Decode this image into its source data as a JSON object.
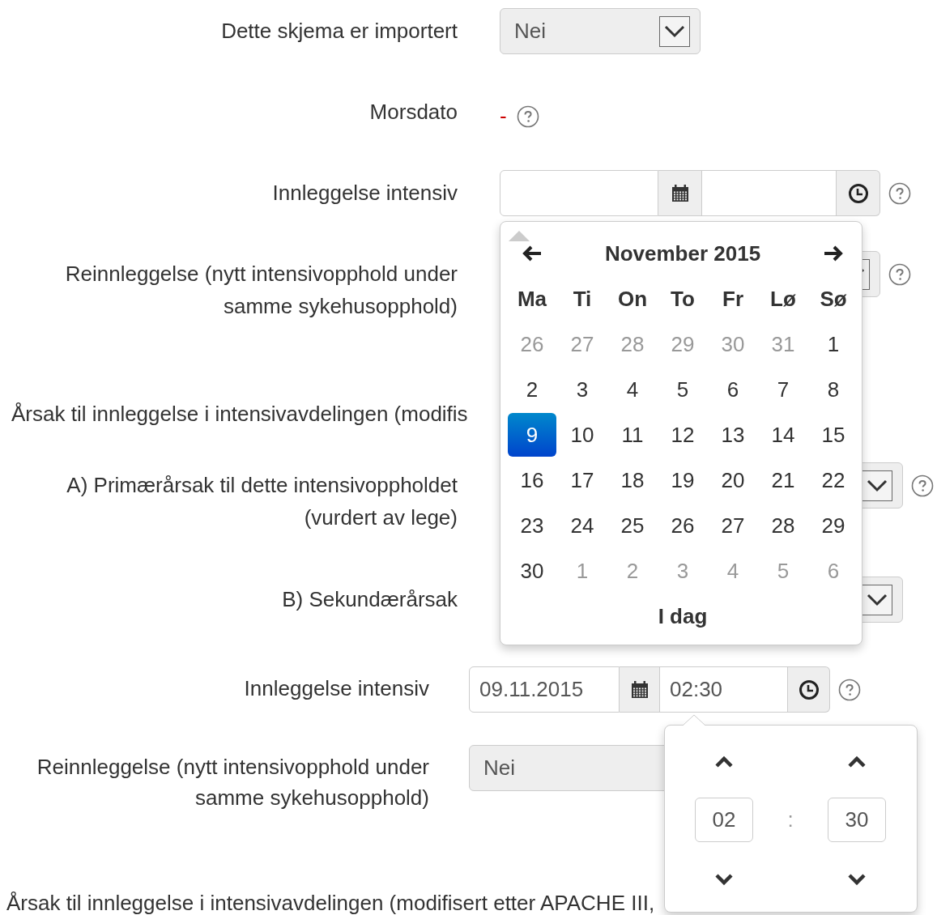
{
  "forms": [
    {
      "rows": [
        {
          "kind": "select",
          "label": "Dette skjema er importert",
          "value": "Nei",
          "help": false
        },
        {
          "kind": "static",
          "label": "Morsdato",
          "value": "-",
          "help": true
        },
        {
          "kind": "datetime",
          "label": "Innleggelse intensiv",
          "help": true
        },
        {
          "kind": "select",
          "label": "Reinnleggelse (nytt intensivopphold under samme sykehusopphold)",
          "help": true
        },
        {
          "kind": "heading",
          "label": "Årsak til innleggelse i intensivavdelingen (modifis"
        },
        {
          "kind": "select",
          "label": "A) Primærårsak til dette intensivoppholdet (vurdert av lege)",
          "help": true
        },
        {
          "kind": "select",
          "label": "B) Sekundærårsak",
          "help": false
        }
      ]
    },
    {
      "rows": [
        {
          "kind": "datetime",
          "label": "Innleggelse intensiv",
          "date": "09.11.2015",
          "time": "02:30",
          "help": true
        },
        {
          "kind": "select",
          "label": "Reinnleggelse (nytt intensivopphold under samme sykehusopphold)",
          "value": "Nei",
          "help": false
        },
        {
          "kind": "heading",
          "label": "Årsak til innleggelse i intensivavdelingen (modifisert etter APACHE III,"
        }
      ]
    }
  ],
  "calendar": {
    "title": "November 2015",
    "weekdays": [
      "Ma",
      "Ti",
      "On",
      "To",
      "Fr",
      "Lø",
      "Sø"
    ],
    "weeks": [
      [
        {
          "day": "26",
          "muted": true,
          "selected": false
        },
        {
          "day": "27",
          "muted": true,
          "selected": false
        },
        {
          "day": "28",
          "muted": true,
          "selected": false
        },
        {
          "day": "29",
          "muted": true,
          "selected": false
        },
        {
          "day": "30",
          "muted": true,
          "selected": false
        },
        {
          "day": "31",
          "muted": true,
          "selected": false
        },
        {
          "day": "1",
          "muted": false,
          "selected": false
        }
      ],
      [
        {
          "day": "2",
          "muted": false,
          "selected": false
        },
        {
          "day": "3",
          "muted": false,
          "selected": false
        },
        {
          "day": "4",
          "muted": false,
          "selected": false
        },
        {
          "day": "5",
          "muted": false,
          "selected": false
        },
        {
          "day": "6",
          "muted": false,
          "selected": false
        },
        {
          "day": "7",
          "muted": false,
          "selected": false
        },
        {
          "day": "8",
          "muted": false,
          "selected": false
        }
      ],
      [
        {
          "day": "9",
          "muted": false,
          "selected": true
        },
        {
          "day": "10",
          "muted": false,
          "selected": false
        },
        {
          "day": "11",
          "muted": false,
          "selected": false
        },
        {
          "day": "12",
          "muted": false,
          "selected": false
        },
        {
          "day": "13",
          "muted": false,
          "selected": false
        },
        {
          "day": "14",
          "muted": false,
          "selected": false
        },
        {
          "day": "15",
          "muted": false,
          "selected": false
        }
      ],
      [
        {
          "day": "16",
          "muted": false,
          "selected": false
        },
        {
          "day": "17",
          "muted": false,
          "selected": false
        },
        {
          "day": "18",
          "muted": false,
          "selected": false
        },
        {
          "day": "19",
          "muted": false,
          "selected": false
        },
        {
          "day": "20",
          "muted": false,
          "selected": false
        },
        {
          "day": "21",
          "muted": false,
          "selected": false
        },
        {
          "day": "22",
          "muted": false,
          "selected": false
        }
      ],
      [
        {
          "day": "23",
          "muted": false,
          "selected": false
        },
        {
          "day": "24",
          "muted": false,
          "selected": false
        },
        {
          "day": "25",
          "muted": false,
          "selected": false
        },
        {
          "day": "26",
          "muted": false,
          "selected": false
        },
        {
          "day": "27",
          "muted": false,
          "selected": false
        },
        {
          "day": "28",
          "muted": false,
          "selected": false
        },
        {
          "day": "29",
          "muted": false,
          "selected": false
        }
      ],
      [
        {
          "day": "30",
          "muted": false,
          "selected": false
        },
        {
          "day": "1",
          "muted": true,
          "selected": false
        },
        {
          "day": "2",
          "muted": true,
          "selected": false
        },
        {
          "day": "3",
          "muted": true,
          "selected": false
        },
        {
          "day": "4",
          "muted": true,
          "selected": false
        },
        {
          "day": "5",
          "muted": true,
          "selected": false
        },
        {
          "day": "6",
          "muted": true,
          "selected": false
        }
      ]
    ],
    "today_button": "I dag"
  },
  "time_picker": {
    "hour": "02",
    "separator": ":",
    "minute": "30"
  }
}
